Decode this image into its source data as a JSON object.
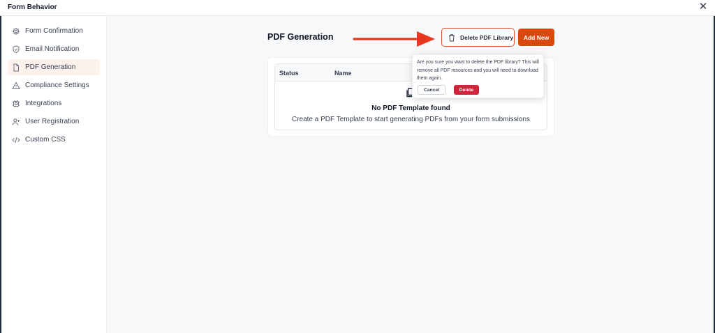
{
  "window": {
    "title": "Form Behavior",
    "close_icon": "close-icon"
  },
  "sidebar": {
    "active_index": 2,
    "items": [
      {
        "label": "Form Confirmation",
        "icon": "gear-icon"
      },
      {
        "label": "Email Notification",
        "icon": "shield-check-icon"
      },
      {
        "label": "PDF Generation",
        "icon": "document-icon"
      },
      {
        "label": "Compliance Settings",
        "icon": "warning-triangle-icon"
      },
      {
        "label": "Integrations",
        "icon": "chip-icon"
      },
      {
        "label": "User Registration",
        "icon": "user-plus-icon"
      },
      {
        "label": "Custom CSS",
        "icon": "code-icon"
      }
    ]
  },
  "main": {
    "page_title": "PDF Generation",
    "delete_library_label": "Delete PDF Library",
    "add_new_label": "Add New",
    "table": {
      "columns": [
        "Status",
        "Name"
      ],
      "empty_title": "No PDF Template found",
      "empty_subtitle": "Create a PDF Template to start generating PDFs from your form submissions"
    }
  },
  "confirm_popover": {
    "message": "Are you sure you want to delete the PDF library? This will remove all PDF resources and you will need to download them again.",
    "cancel_label": "Cancel",
    "delete_label": "Delete"
  },
  "colors": {
    "accent": "#d9480f",
    "danger": "#d1243a",
    "annotation_arrow": "#e8371f",
    "active_nav_bg": "#fdf1ec",
    "content_bg": "#f6f8fa"
  }
}
